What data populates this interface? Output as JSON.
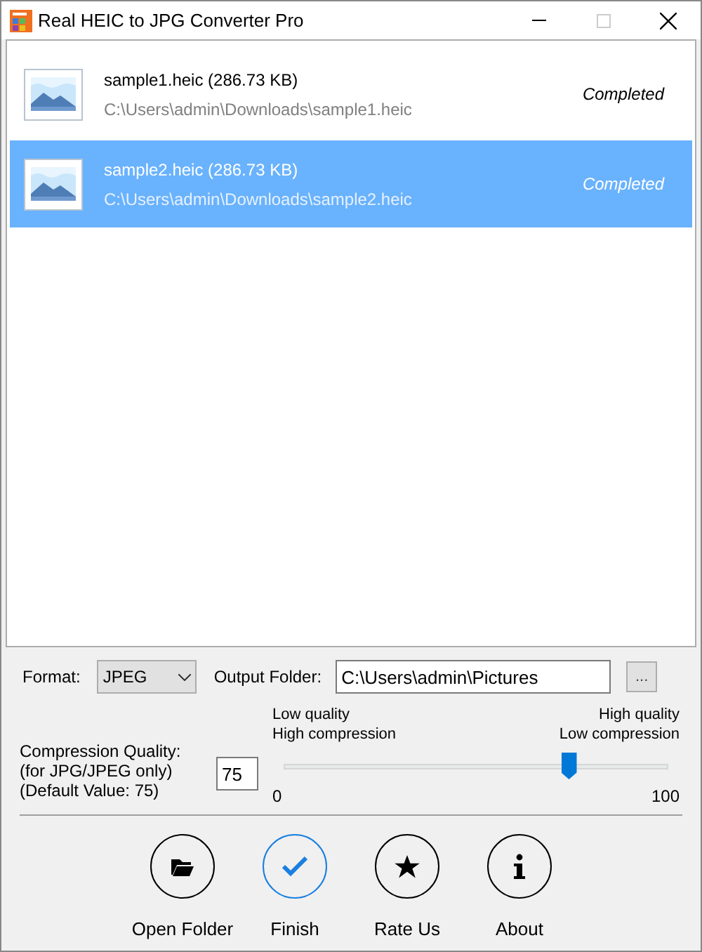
{
  "window": {
    "title": "Real HEIC to JPG Converter Pro"
  },
  "files": [
    {
      "name": "sample1.heic (286.73 KB)",
      "path": "C:\\Users\\admin\\Downloads\\sample1.heic",
      "status": "Completed",
      "selected": false
    },
    {
      "name": "sample2.heic (286.73 KB)",
      "path": "C:\\Users\\admin\\Downloads\\sample2.heic",
      "status": "Completed",
      "selected": true
    }
  ],
  "format": {
    "label": "Format:",
    "value": "JPEG"
  },
  "output_folder": {
    "label": "Output Folder:",
    "value": "C:\\Users\\admin\\Pictures",
    "browse": "..."
  },
  "quality": {
    "label_lines": [
      "Compression Quality:",
      "(for JPG/JPEG only)",
      "(Default Value: 75)"
    ],
    "value": "75",
    "low_lines": [
      "Low quality",
      "High compression"
    ],
    "high_lines": [
      "High quality",
      "Low compression"
    ],
    "min": "0",
    "max": "100",
    "level": 0.74
  },
  "actions": [
    {
      "kind": "folder",
      "label": "Open Folder",
      "selected": false
    },
    {
      "kind": "check",
      "label": "Finish",
      "selected": true
    },
    {
      "kind": "star",
      "label": "Rate Us",
      "selected": false
    },
    {
      "kind": "info",
      "label": "About",
      "selected": false
    }
  ]
}
